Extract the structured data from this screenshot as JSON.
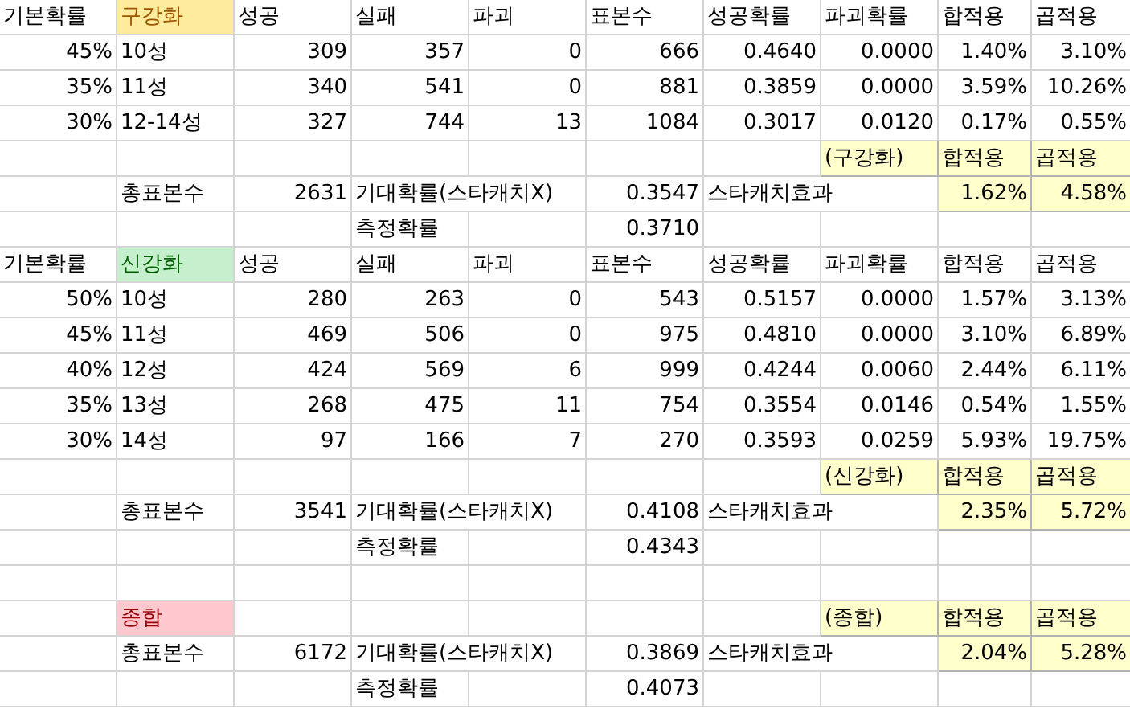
{
  "sections": [
    {
      "kind": "table",
      "base_header": "기본확률",
      "label": "구강화",
      "color": "#ffeb9c",
      "columns": [
        "성공",
        "실패",
        "파괴",
        "표본수",
        "성공확률",
        "파괴확률",
        "합적용",
        "곱적용"
      ],
      "rows": [
        {
          "base": "45%",
          "star": "10성",
          "values": [
            "309",
            "357",
            "0",
            "666",
            "0.4640",
            "0.0000",
            "1.40%",
            "3.10%"
          ]
        },
        {
          "base": "35%",
          "star": "11성",
          "values": [
            "340",
            "541",
            "0",
            "881",
            "0.3859",
            "0.0000",
            "3.59%",
            "10.26%"
          ]
        },
        {
          "base": "30%",
          "star": "12-14성",
          "values": [
            "327",
            "744",
            "13",
            "1084",
            "0.3017",
            "0.0120",
            "0.17%",
            "0.55%"
          ]
        }
      ],
      "summary_header": [
        "(구강화)",
        "합적용",
        "곱적용"
      ],
      "total_label": "총표본수",
      "total": "2631",
      "expected_label": "기대확률(스타캐치X)",
      "expected": "0.3547",
      "effect_label": "스타캐치효과",
      "effect_sum": "1.62%",
      "effect_product": "4.58%",
      "measured_label": "측정확률",
      "measured": "0.3710"
    },
    {
      "kind": "table",
      "base_header": "기본확률",
      "label": "신강화",
      "color": "#c6efce",
      "columns": [
        "성공",
        "실패",
        "파괴",
        "표본수",
        "성공확률",
        "파괴확률",
        "합적용",
        "곱적용"
      ],
      "rows": [
        {
          "base": "50%",
          "star": "10성",
          "values": [
            "280",
            "263",
            "0",
            "543",
            "0.5157",
            "0.0000",
            "1.57%",
            "3.13%"
          ]
        },
        {
          "base": "45%",
          "star": "11성",
          "values": [
            "469",
            "506",
            "0",
            "975",
            "0.4810",
            "0.0000",
            "3.10%",
            "6.89%"
          ]
        },
        {
          "base": "40%",
          "star": "12성",
          "values": [
            "424",
            "569",
            "6",
            "999",
            "0.4244",
            "0.0060",
            "2.44%",
            "6.11%"
          ]
        },
        {
          "base": "35%",
          "star": "13성",
          "values": [
            "268",
            "475",
            "11",
            "754",
            "0.3554",
            "0.0146",
            "0.54%",
            "1.55%"
          ]
        },
        {
          "base": "30%",
          "star": "14성",
          "values": [
            "97",
            "166",
            "7",
            "270",
            "0.3593",
            "0.0259",
            "5.93%",
            "19.75%"
          ]
        }
      ],
      "summary_header": [
        "(신강화)",
        "합적용",
        "곱적용"
      ],
      "total_label": "총표본수",
      "total": "3541",
      "expected_label": "기대확률(스타캐치X)",
      "expected": "0.4108",
      "effect_label": "스타캐치효과",
      "effect_sum": "2.35%",
      "effect_product": "5.72%",
      "measured_label": "측정확률",
      "measured": "0.4343"
    },
    {
      "kind": "overall",
      "label": "종합",
      "color": "#ffc7ce",
      "summary_header": [
        "(종합)",
        "합적용",
        "곱적용"
      ],
      "total_label": "총표본수",
      "total": "6172",
      "expected_label": "기대확률(스타캐치X)",
      "expected": "0.3869",
      "effect_label": "스타캐치효과",
      "effect_sum": "2.04%",
      "effect_product": "5.28%",
      "measured_label": "측정확률",
      "measured": "0.4073"
    }
  ]
}
